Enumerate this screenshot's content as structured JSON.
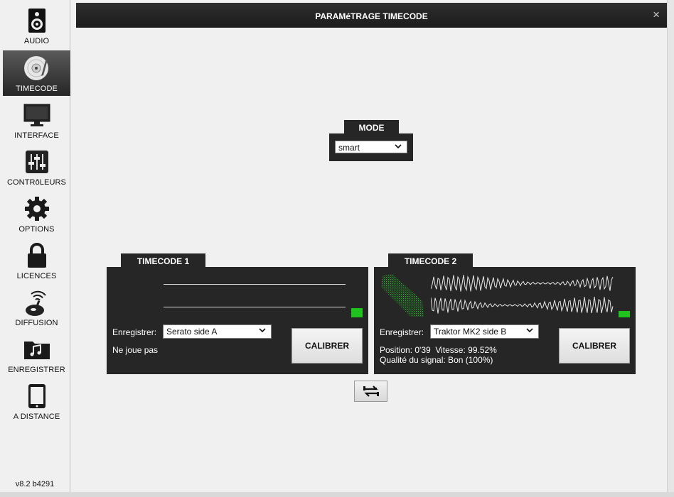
{
  "sidebar": {
    "items": [
      {
        "label": "AUDIO",
        "icon": "speaker-icon"
      },
      {
        "label": "TIMECODE",
        "icon": "vinyl-record-icon",
        "active": true
      },
      {
        "label": "INTERFACE",
        "icon": "monitor-icon"
      },
      {
        "label": "CONTRôLEURS",
        "icon": "mixer-sliders-icon"
      },
      {
        "label": "OPTIONS",
        "icon": "gear-icon"
      },
      {
        "label": "LICENCES",
        "icon": "padlock-icon"
      },
      {
        "label": "DIFFUSION",
        "icon": "broadcast-mic-icon"
      },
      {
        "label": "ENREGISTRER",
        "icon": "music-folder-icon"
      },
      {
        "label": "A DISTANCE",
        "icon": "tablet-icon"
      }
    ],
    "version": "v8.2 b4291"
  },
  "window": {
    "title": "PARAMéTRAGE TIMECODE",
    "close": "×"
  },
  "mode": {
    "label": "MODE",
    "value": "smart"
  },
  "timecode1": {
    "label": "TIMECODE 1",
    "record_label": "Enregistrer:",
    "record_value": "Serato side A",
    "status": "Ne joue pas",
    "calibrate": "CALIBRER"
  },
  "timecode2": {
    "label": "TIMECODE 2",
    "record_label": "Enregistrer:",
    "record_value": "Traktor MK2 side B",
    "status_line1": "Position: 0'39  Vitesse: 99.52%",
    "status_line2": "Qualité du signal: Bon (100%)",
    "calibrate": "CALIBRER"
  },
  "colors": {
    "panel": "#262626",
    "led": "#1ec31e",
    "scope": "#2db82d",
    "active_sidebar": "#3a3a3a"
  }
}
